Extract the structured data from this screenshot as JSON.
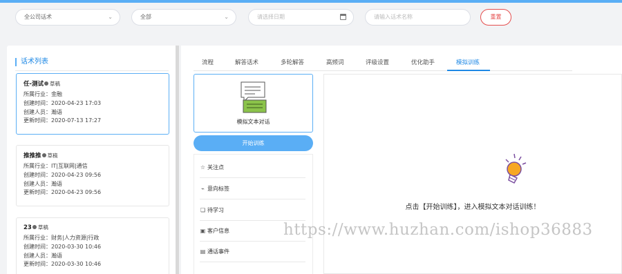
{
  "filters": {
    "category": "全公司话术",
    "status": "全部",
    "date_placeholder": "请选择日期",
    "name_placeholder": "请输入话术名称",
    "reset_label": "重置"
  },
  "left": {
    "title": "话术列表",
    "cards": [
      {
        "name": "任-测试",
        "status": "草稿",
        "industry": "所属行业：金融",
        "created": "创建时间：2020-04-23 17:03",
        "creator": "创建人员：瀚语",
        "updated": "更新时间：2020-07-13 17:27"
      },
      {
        "name": "推推推",
        "status": "草稿",
        "industry": "所属行业：IT|互联网|通信",
        "created": "创建时间：2020-04-23 09:56",
        "creator": "创建人员：瀚语",
        "updated": "更新时间：2020-04-23 09:56"
      },
      {
        "name": "23",
        "status": "草稿",
        "industry": "所属行业：财务|人力资源|行政",
        "created": "创建时间：2020-03-30 10:46",
        "creator": "创建人员：瀚语",
        "updated": "更新时间：2020-03-30 10:46"
      }
    ]
  },
  "tabs": [
    "流程",
    "解答话术",
    "多轮解答",
    "高频词",
    "评级设置",
    "优化助手",
    "模拟训练"
  ],
  "sim": {
    "box_label": "模拟文本对话",
    "start_label": "开始训练",
    "menu": [
      "关注点",
      "意向标签",
      "待学习",
      "客户信息",
      "通话事件"
    ],
    "hint": "点击【开始训练】，进入模拟文本对话训练！"
  },
  "watermark": "https://www.huzhan.com/ishop36883",
  "colors": {
    "accent": "#5aaef5",
    "link": "#1e88e5",
    "danger": "#e54d4d",
    "bulb": "#f7a823"
  }
}
